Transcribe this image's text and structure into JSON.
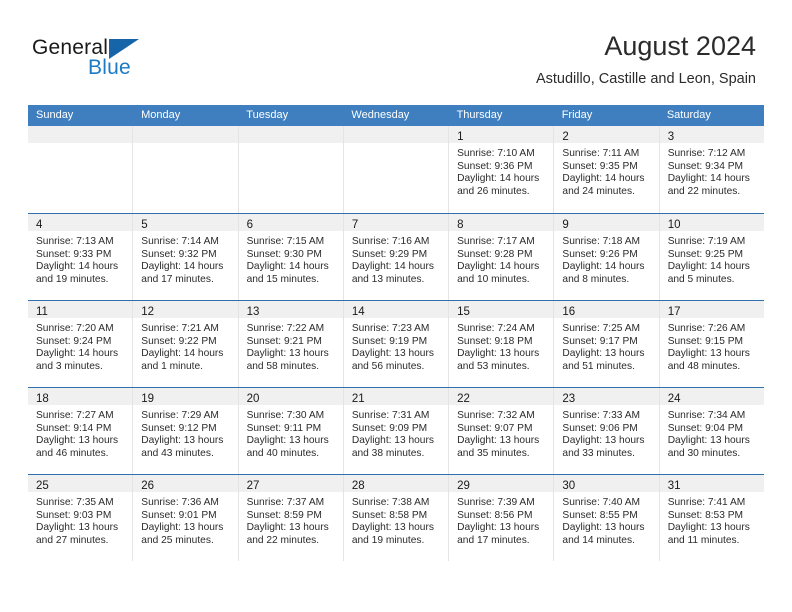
{
  "brand": {
    "name_top": "General",
    "name_bottom": "Blue",
    "triangle_color": "#1565a8",
    "blue_color": "#1c7bc4"
  },
  "header": {
    "month_title": "August 2024",
    "location": "Astudillo, Castille and Leon, Spain"
  },
  "theme": {
    "header_bar_color": "#3f7fbf",
    "week_divider_color": "#2f6fae",
    "day_band_color": "#f0f0f0"
  },
  "weekdays": [
    "Sunday",
    "Monday",
    "Tuesday",
    "Wednesday",
    "Thursday",
    "Friday",
    "Saturday"
  ],
  "weeks": [
    [
      {
        "day": "",
        "empty": true
      },
      {
        "day": "",
        "empty": true
      },
      {
        "day": "",
        "empty": true
      },
      {
        "day": "",
        "empty": true
      },
      {
        "day": "1",
        "sunrise": "Sunrise: 7:10 AM",
        "sunset": "Sunset: 9:36 PM",
        "daylight_1": "Daylight: 14 hours",
        "daylight_2": "and 26 minutes."
      },
      {
        "day": "2",
        "sunrise": "Sunrise: 7:11 AM",
        "sunset": "Sunset: 9:35 PM",
        "daylight_1": "Daylight: 14 hours",
        "daylight_2": "and 24 minutes."
      },
      {
        "day": "3",
        "sunrise": "Sunrise: 7:12 AM",
        "sunset": "Sunset: 9:34 PM",
        "daylight_1": "Daylight: 14 hours",
        "daylight_2": "and 22 minutes."
      }
    ],
    [
      {
        "day": "4",
        "sunrise": "Sunrise: 7:13 AM",
        "sunset": "Sunset: 9:33 PM",
        "daylight_1": "Daylight: 14 hours",
        "daylight_2": "and 19 minutes."
      },
      {
        "day": "5",
        "sunrise": "Sunrise: 7:14 AM",
        "sunset": "Sunset: 9:32 PM",
        "daylight_1": "Daylight: 14 hours",
        "daylight_2": "and 17 minutes."
      },
      {
        "day": "6",
        "sunrise": "Sunrise: 7:15 AM",
        "sunset": "Sunset: 9:30 PM",
        "daylight_1": "Daylight: 14 hours",
        "daylight_2": "and 15 minutes."
      },
      {
        "day": "7",
        "sunrise": "Sunrise: 7:16 AM",
        "sunset": "Sunset: 9:29 PM",
        "daylight_1": "Daylight: 14 hours",
        "daylight_2": "and 13 minutes."
      },
      {
        "day": "8",
        "sunrise": "Sunrise: 7:17 AM",
        "sunset": "Sunset: 9:28 PM",
        "daylight_1": "Daylight: 14 hours",
        "daylight_2": "and 10 minutes."
      },
      {
        "day": "9",
        "sunrise": "Sunrise: 7:18 AM",
        "sunset": "Sunset: 9:26 PM",
        "daylight_1": "Daylight: 14 hours",
        "daylight_2": "and 8 minutes."
      },
      {
        "day": "10",
        "sunrise": "Sunrise: 7:19 AM",
        "sunset": "Sunset: 9:25 PM",
        "daylight_1": "Daylight: 14 hours",
        "daylight_2": "and 5 minutes."
      }
    ],
    [
      {
        "day": "11",
        "sunrise": "Sunrise: 7:20 AM",
        "sunset": "Sunset: 9:24 PM",
        "daylight_1": "Daylight: 14 hours",
        "daylight_2": "and 3 minutes."
      },
      {
        "day": "12",
        "sunrise": "Sunrise: 7:21 AM",
        "sunset": "Sunset: 9:22 PM",
        "daylight_1": "Daylight: 14 hours",
        "daylight_2": "and 1 minute."
      },
      {
        "day": "13",
        "sunrise": "Sunrise: 7:22 AM",
        "sunset": "Sunset: 9:21 PM",
        "daylight_1": "Daylight: 13 hours",
        "daylight_2": "and 58 minutes."
      },
      {
        "day": "14",
        "sunrise": "Sunrise: 7:23 AM",
        "sunset": "Sunset: 9:19 PM",
        "daylight_1": "Daylight: 13 hours",
        "daylight_2": "and 56 minutes."
      },
      {
        "day": "15",
        "sunrise": "Sunrise: 7:24 AM",
        "sunset": "Sunset: 9:18 PM",
        "daylight_1": "Daylight: 13 hours",
        "daylight_2": "and 53 minutes."
      },
      {
        "day": "16",
        "sunrise": "Sunrise: 7:25 AM",
        "sunset": "Sunset: 9:17 PM",
        "daylight_1": "Daylight: 13 hours",
        "daylight_2": "and 51 minutes."
      },
      {
        "day": "17",
        "sunrise": "Sunrise: 7:26 AM",
        "sunset": "Sunset: 9:15 PM",
        "daylight_1": "Daylight: 13 hours",
        "daylight_2": "and 48 minutes."
      }
    ],
    [
      {
        "day": "18",
        "sunrise": "Sunrise: 7:27 AM",
        "sunset": "Sunset: 9:14 PM",
        "daylight_1": "Daylight: 13 hours",
        "daylight_2": "and 46 minutes."
      },
      {
        "day": "19",
        "sunrise": "Sunrise: 7:29 AM",
        "sunset": "Sunset: 9:12 PM",
        "daylight_1": "Daylight: 13 hours",
        "daylight_2": "and 43 minutes."
      },
      {
        "day": "20",
        "sunrise": "Sunrise: 7:30 AM",
        "sunset": "Sunset: 9:11 PM",
        "daylight_1": "Daylight: 13 hours",
        "daylight_2": "and 40 minutes."
      },
      {
        "day": "21",
        "sunrise": "Sunrise: 7:31 AM",
        "sunset": "Sunset: 9:09 PM",
        "daylight_1": "Daylight: 13 hours",
        "daylight_2": "and 38 minutes."
      },
      {
        "day": "22",
        "sunrise": "Sunrise: 7:32 AM",
        "sunset": "Sunset: 9:07 PM",
        "daylight_1": "Daylight: 13 hours",
        "daylight_2": "and 35 minutes."
      },
      {
        "day": "23",
        "sunrise": "Sunrise: 7:33 AM",
        "sunset": "Sunset: 9:06 PM",
        "daylight_1": "Daylight: 13 hours",
        "daylight_2": "and 33 minutes."
      },
      {
        "day": "24",
        "sunrise": "Sunrise: 7:34 AM",
        "sunset": "Sunset: 9:04 PM",
        "daylight_1": "Daylight: 13 hours",
        "daylight_2": "and 30 minutes."
      }
    ],
    [
      {
        "day": "25",
        "sunrise": "Sunrise: 7:35 AM",
        "sunset": "Sunset: 9:03 PM",
        "daylight_1": "Daylight: 13 hours",
        "daylight_2": "and 27 minutes."
      },
      {
        "day": "26",
        "sunrise": "Sunrise: 7:36 AM",
        "sunset": "Sunset: 9:01 PM",
        "daylight_1": "Daylight: 13 hours",
        "daylight_2": "and 25 minutes."
      },
      {
        "day": "27",
        "sunrise": "Sunrise: 7:37 AM",
        "sunset": "Sunset: 8:59 PM",
        "daylight_1": "Daylight: 13 hours",
        "daylight_2": "and 22 minutes."
      },
      {
        "day": "28",
        "sunrise": "Sunrise: 7:38 AM",
        "sunset": "Sunset: 8:58 PM",
        "daylight_1": "Daylight: 13 hours",
        "daylight_2": "and 19 minutes."
      },
      {
        "day": "29",
        "sunrise": "Sunrise: 7:39 AM",
        "sunset": "Sunset: 8:56 PM",
        "daylight_1": "Daylight: 13 hours",
        "daylight_2": "and 17 minutes."
      },
      {
        "day": "30",
        "sunrise": "Sunrise: 7:40 AM",
        "sunset": "Sunset: 8:55 PM",
        "daylight_1": "Daylight: 13 hours",
        "daylight_2": "and 14 minutes."
      },
      {
        "day": "31",
        "sunrise": "Sunrise: 7:41 AM",
        "sunset": "Sunset: 8:53 PM",
        "daylight_1": "Daylight: 13 hours",
        "daylight_2": "and 11 minutes."
      }
    ]
  ]
}
